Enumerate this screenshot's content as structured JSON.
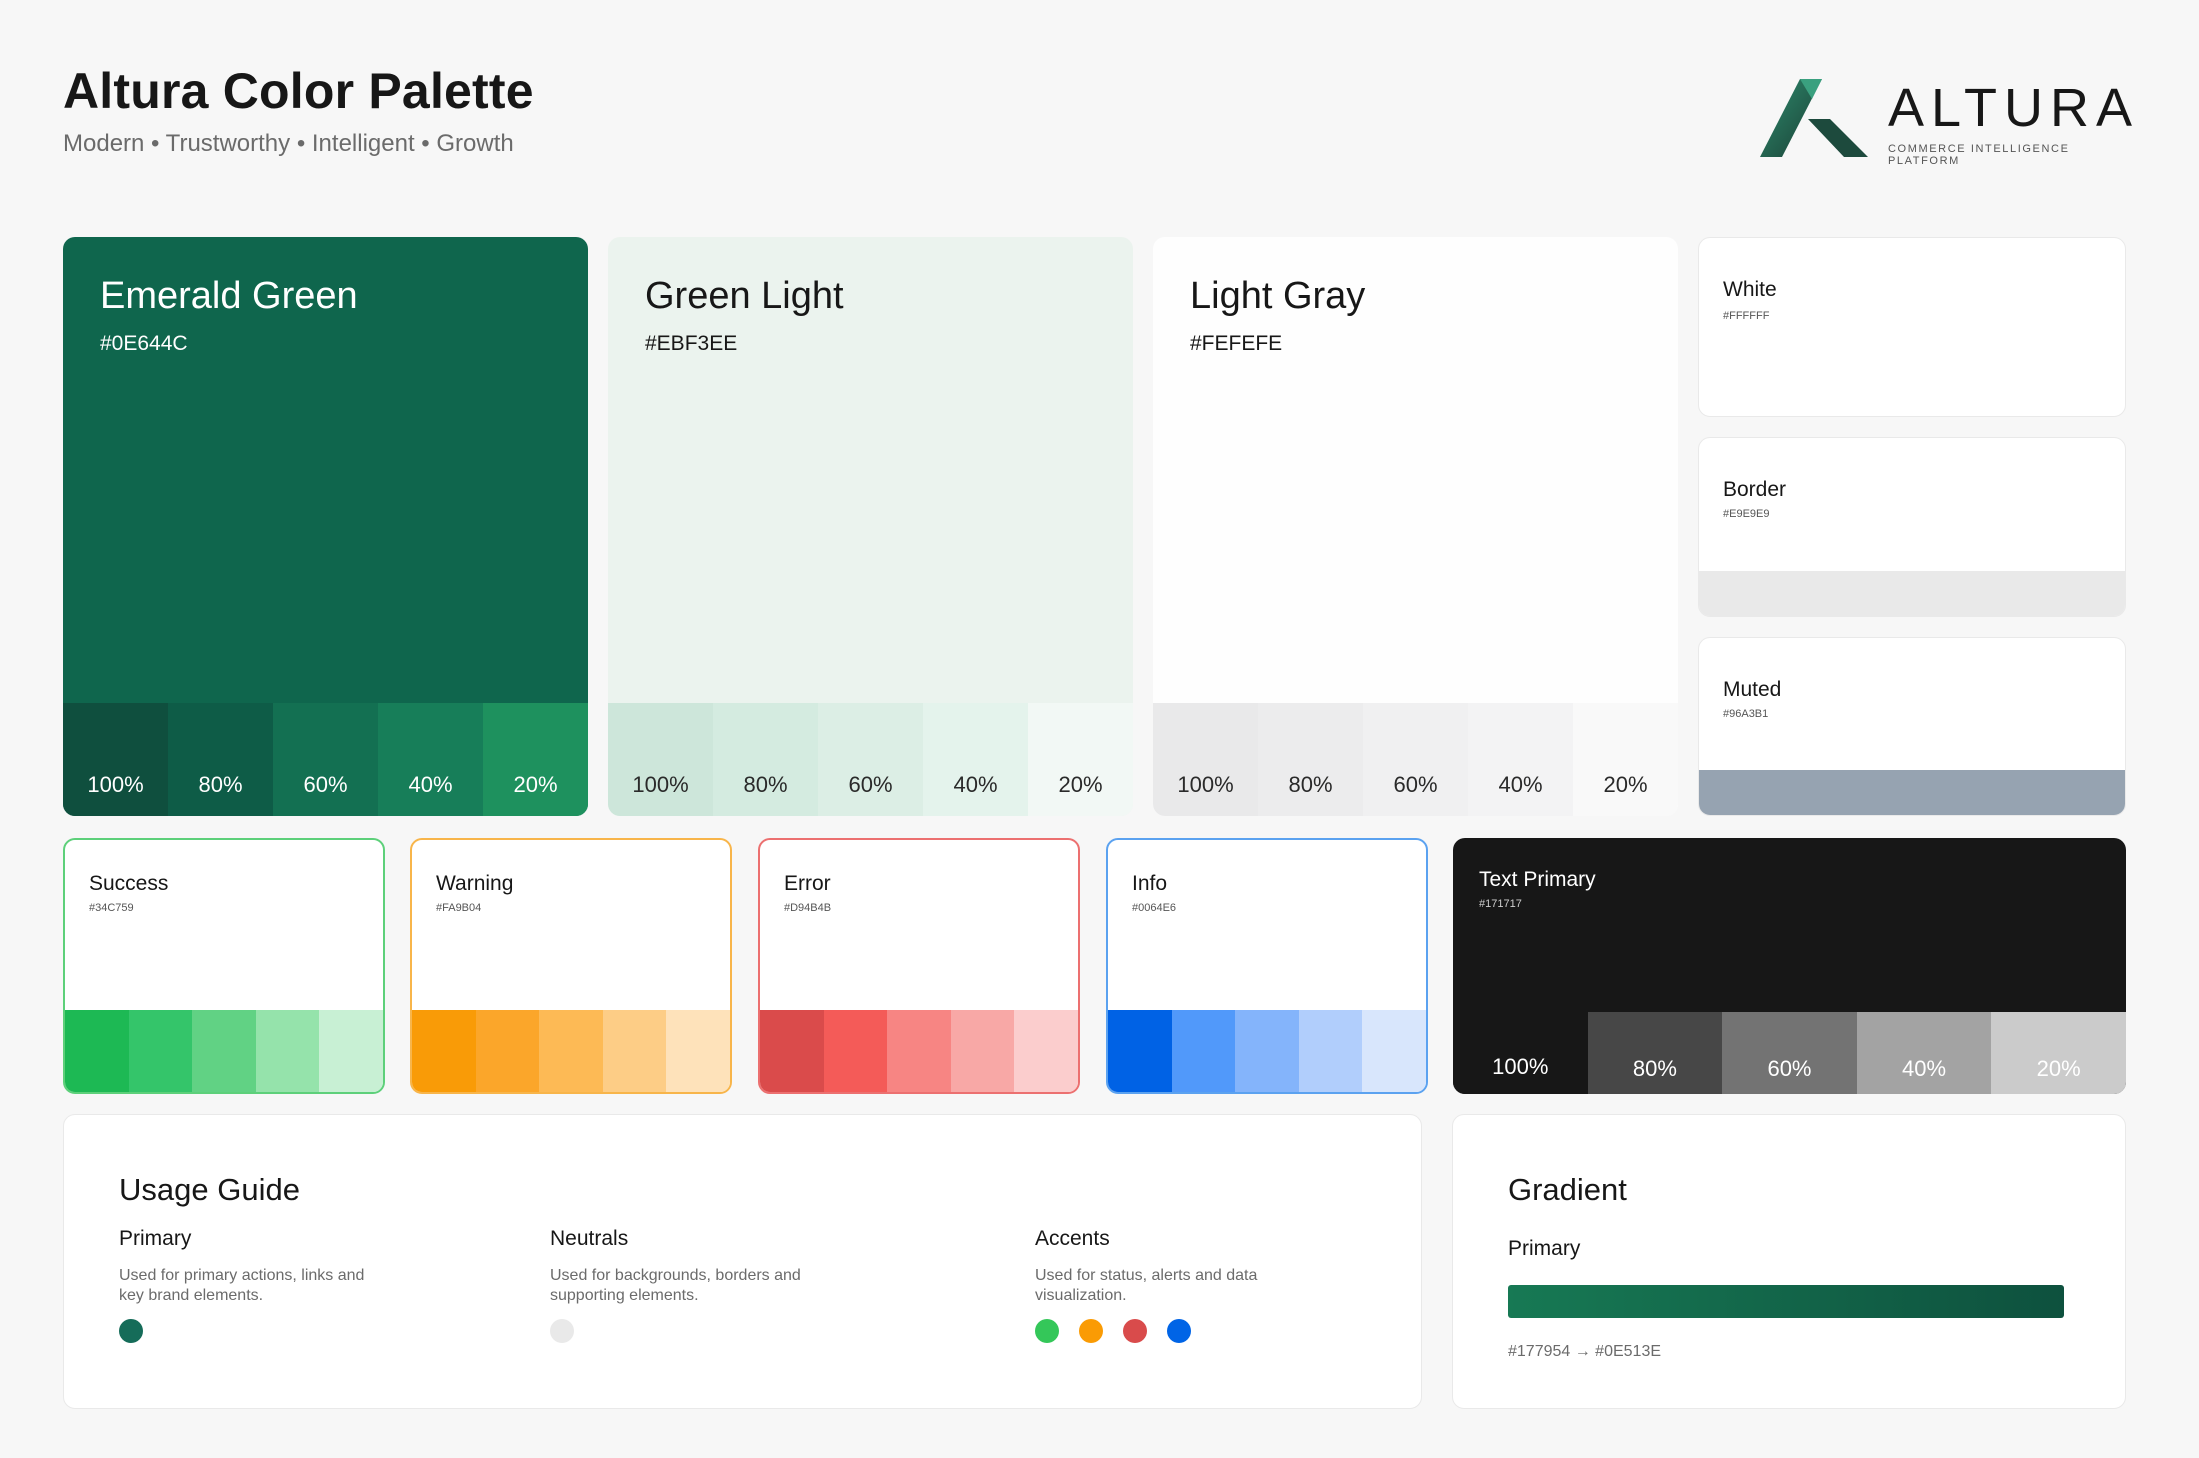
{
  "header": {
    "title": "Altura Color Palette",
    "subtitle": "Modern • Trustworthy • Intelligent • Growth"
  },
  "logo": {
    "wordmark": "ALTURA",
    "tagline": "COMMERCE INTELLIGENCE PLATFORM",
    "mark_icon": "altura-mountain-logo"
  },
  "primary_swatches": [
    {
      "name": "Emerald Green",
      "hex": "#0E644C",
      "tints": [
        "100%",
        "80%",
        "60%",
        "40%",
        "20%"
      ],
      "tint_colors": [
        "#0F4F3E",
        "#0E5C47",
        "#137052",
        "#177E59",
        "#1E915E"
      ]
    },
    {
      "name": "Green Light",
      "hex": "#EBF3EE",
      "tints": [
        "100%",
        "80%",
        "60%",
        "40%",
        "20%"
      ],
      "tint_colors": [
        "#CDE6DA",
        "#D4EBE0",
        "#DCEEE5",
        "#E4F3EC",
        "#F2F8F5"
      ]
    },
    {
      "name": "Light Gray",
      "hex": "#FEFEFE",
      "tints": [
        "100%",
        "80%",
        "60%",
        "40%",
        "20%"
      ],
      "tint_colors": [
        "#E9E9EA",
        "#ECECED",
        "#F0F0F1",
        "#F3F3F4",
        "#F9F9F9"
      ]
    }
  ],
  "neutrals": [
    {
      "name": "White",
      "hex": "#FFFFFF"
    },
    {
      "name": "Border",
      "hex": "#E9E9E9"
    },
    {
      "name": "Muted",
      "hex": "#96A3B1"
    }
  ],
  "status": [
    {
      "name": "Success",
      "hex": "#34C759",
      "border": "#5DD07A",
      "tint_colors": [
        "#1DB954",
        "#34C56A",
        "#61D284",
        "#95E3AB",
        "#C8F0D4"
      ]
    },
    {
      "name": "Warning",
      "hex": "#FA9B04",
      "border": "#F8B54A",
      "tint_colors": [
        "#F99B07",
        "#FBA62A",
        "#FDBA55",
        "#FDCD86",
        "#FEE2BA"
      ]
    },
    {
      "name": "Error",
      "hex": "#D94B4B",
      "border": "#EC7070",
      "tint_colors": [
        "#DA4B4B",
        "#F45B58",
        "#F78583",
        "#F8A8A6",
        "#FBCDCD"
      ]
    },
    {
      "name": "Info",
      "hex": "#0064E6",
      "border": "#5BA2F0",
      "tint_colors": [
        "#0062E5",
        "#5199FA",
        "#84B4FB",
        "#B1CEFC",
        "#D8E6FC"
      ]
    }
  ],
  "text_primary": {
    "name": "Text Primary",
    "hex": "#171717",
    "tints": [
      "100%",
      "80%",
      "60%",
      "40%",
      "20%"
    ],
    "tint_colors": [
      "#171717",
      "#474747",
      "#737373",
      "#A3A3A3",
      "#CBCBCB"
    ]
  },
  "usage": {
    "title": "Usage Guide",
    "columns": [
      {
        "heading": "Primary",
        "desc": "Used for primary actions, links and key brand elements.",
        "dots": [
          "#156C59"
        ]
      },
      {
        "heading": "Neutrals",
        "desc": "Used for backgrounds, borders and supporting elements.",
        "dots": [
          "#E9E9E9"
        ]
      },
      {
        "heading": "Accents",
        "desc": "Used for status, alerts and data visualization.",
        "dots": [
          "#34C759",
          "#FA9B04",
          "#D94B4B",
          "#0064E6"
        ]
      }
    ]
  },
  "gradient": {
    "title": "Gradient",
    "label": "Primary",
    "from": "#177954",
    "to": "#0E513E",
    "caption": "#177954 → #0E513E"
  }
}
